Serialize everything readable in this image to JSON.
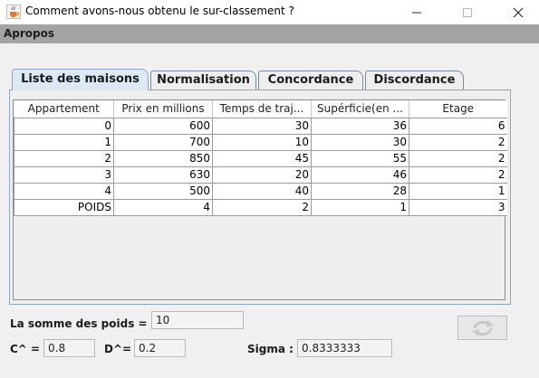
{
  "window": {
    "title": "Comment avons-nous obtenu le sur-classement ?",
    "icon": "java-cup-icon"
  },
  "menu": {
    "items": [
      "Apropos"
    ]
  },
  "tabs": [
    {
      "label": "Liste des maisons",
      "active": true
    },
    {
      "label": "Normalisation",
      "active": false
    },
    {
      "label": "Concordance",
      "active": false
    },
    {
      "label": "Discordance",
      "active": false
    }
  ],
  "table": {
    "headers": [
      "Appartement",
      "Prix en millions",
      "Temps de traj...",
      "Supérficie(en ...",
      "Etage"
    ],
    "rows": [
      [
        "0",
        "600",
        "30",
        "36",
        "6"
      ],
      [
        "1",
        "700",
        "10",
        "30",
        "2"
      ],
      [
        "2",
        "850",
        "45",
        "55",
        "2"
      ],
      [
        "3",
        "630",
        "20",
        "46",
        "2"
      ],
      [
        "4",
        "500",
        "40",
        "28",
        "1"
      ],
      [
        "POIDS",
        "4",
        "2",
        "1",
        "3"
      ]
    ]
  },
  "summary": {
    "somme_label": "La somme des poids =",
    "somme_value": "10",
    "c_label": "C^ =",
    "c_value": "0.8",
    "d_label": "D^=",
    "d_value": "0.2",
    "sigma_label": "Sigma :",
    "sigma_value": "0.8333333"
  },
  "refresh_button": {
    "icon": "refresh-icon"
  }
}
